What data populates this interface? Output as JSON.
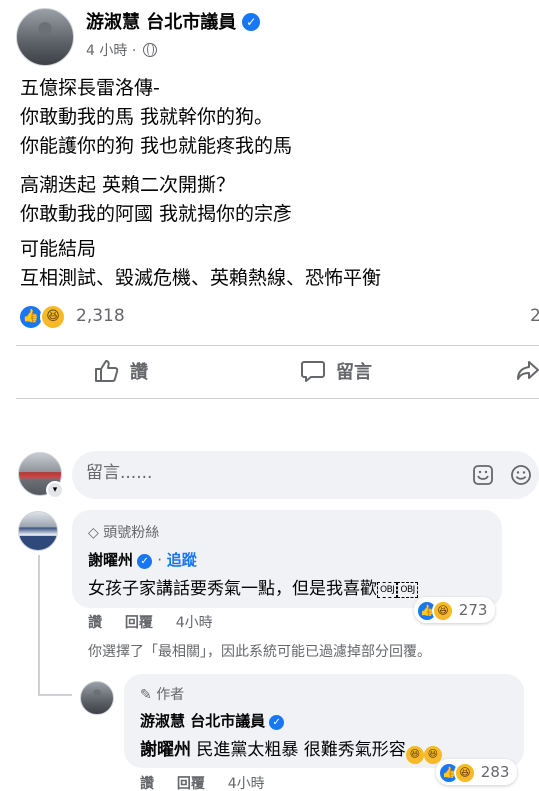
{
  "post": {
    "author_name": "游淑慧 台北市議員",
    "timestamp": "4 小時",
    "separator": "·",
    "lines": [
      "五億探長雷洛傳-",
      "你敢動我的馬 我就幹你的狗。",
      "你能護你的狗 我也就能疼我的馬",
      "高潮迭起 英賴二次開撕？",
      "你敢動我的阿國 我就揭你的宗彥",
      "可能結局",
      "互相測試、毀滅危機、英賴熱線、恐怖平衡"
    ],
    "reaction_count": "2,318",
    "edge_count": "2"
  },
  "actions": {
    "like_label": "讚",
    "comment_label": "留言"
  },
  "composer": {
    "placeholder": "留言......"
  },
  "comments": [
    {
      "badge": "頭號粉絲",
      "name": "謝曜州",
      "follow_label": "追蹤",
      "text": "女孩子家講話要秀氣一點，但是我喜歡",
      "obj_tokens": [
        "OBJ",
        "OBJ"
      ],
      "reaction_count": "273",
      "like_label": "讚",
      "reply_label": "回覆",
      "time": "4小時"
    },
    {
      "badge": "作者",
      "name": "游淑慧 台北市議員",
      "mention": "謝曜州",
      "text": "民進黨太粗暴 很難秀氣形容",
      "reaction_count": "283",
      "like_label": "讚",
      "reply_label": "回覆",
      "time": "4小時"
    }
  ],
  "filter_note": "你選擇了「最相關」，因此系統可能已過濾掉部分回覆。",
  "colors": {
    "accent": "#1877f2",
    "secondary_text": "#65676b",
    "bubble": "#f0f2f5",
    "haha": "#f7b928"
  },
  "icons": {
    "verified": "✓",
    "like": "👍",
    "haha": "😆",
    "fan": "◇",
    "author": "✎"
  }
}
